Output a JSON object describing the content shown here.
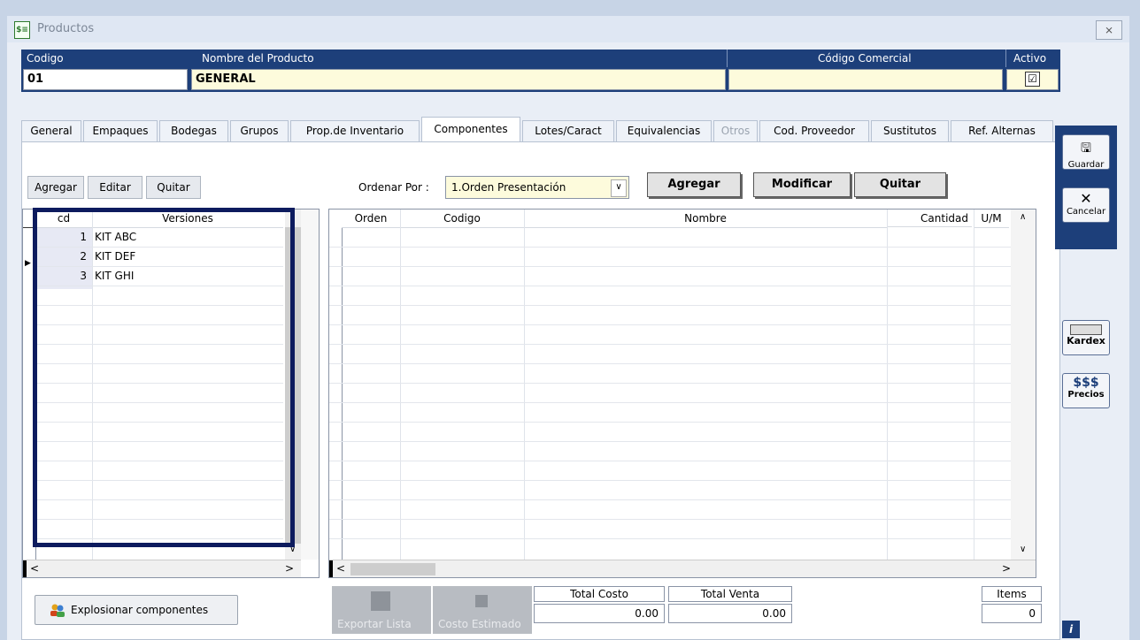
{
  "window": {
    "title": "Productos",
    "close_label": "⨯"
  },
  "header": {
    "codigo_label": "Codigo",
    "nombre_label": "Nombre del Producto",
    "codigo_comercial_label": "Código Comercial",
    "activo_label": "Activo",
    "codigo_value": "01",
    "nombre_value": "GENERAL",
    "codigo_comercial_value": "",
    "activo_checked": "☑"
  },
  "tabs": [
    {
      "label": "General"
    },
    {
      "label": "Empaques"
    },
    {
      "label": "Bodegas"
    },
    {
      "label": "Grupos"
    },
    {
      "label": "Prop.de Inventario"
    },
    {
      "label": "Componentes"
    },
    {
      "label": "Lotes/Caract"
    },
    {
      "label": "Equivalencias"
    },
    {
      "label": "Otros"
    },
    {
      "label": "Cod. Proveedor"
    },
    {
      "label": "Sustitutos"
    },
    {
      "label": "Ref. Alternas"
    }
  ],
  "versions_toolbar": {
    "add": "Agregar",
    "edit": "Editar",
    "remove": "Quitar"
  },
  "versions_grid": {
    "columns": [
      "cd",
      "Versiones"
    ],
    "rows": [
      {
        "cd": "1",
        "name": "KIT ABC"
      },
      {
        "cd": "2",
        "name": "KIT DEF"
      },
      {
        "cd": "3",
        "name": "KIT GHI"
      }
    ],
    "row_pointer": "▶"
  },
  "order": {
    "label": "Ordenar Por :",
    "value": "1.Orden Presentación"
  },
  "components_toolbar": {
    "add": "Agregar",
    "modify": "Modificar",
    "remove": "Quitar"
  },
  "components_grid": {
    "columns": [
      "Orden",
      "Codigo",
      "Nombre",
      "Cantidad",
      "U/M"
    ]
  },
  "bottom": {
    "explode_label": "Explosionar componentes",
    "export_label": "Exportar Lista",
    "cost_est_label": "Costo Estimado",
    "total_costo_label": "Total Costo",
    "total_venta_label": "Total Venta",
    "items_label": "Items",
    "total_costo_value": "0.00",
    "total_venta_value": "0.00",
    "items_value": "0"
  },
  "sidebar": {
    "save_label": "Guardar",
    "cancel_label": "Cancelar",
    "kardex_label": "Kardex",
    "prices_symbol": "$$$",
    "prices_label": "Precios",
    "info_label": "i"
  },
  "colors": {
    "header_bg": "#1d3f7a",
    "highlight_border": "#0d1b5e",
    "input_bg": "#fdfbdc"
  }
}
